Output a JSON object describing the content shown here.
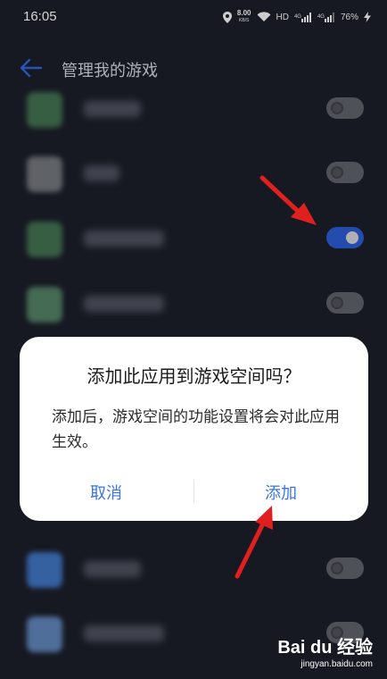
{
  "status_bar": {
    "time": "16:05",
    "net_speed_value": "8.00",
    "net_speed_unit": "KB/S",
    "hd_label": "HD",
    "sig1_label": "4G",
    "sig2_label": "4G",
    "battery": "76%",
    "icons": [
      "location-icon",
      "wifi-icon",
      "signal-icon",
      "signal-icon",
      "charging-icon"
    ]
  },
  "header": {
    "title": "管理我的游戏",
    "back_icon": "arrow-left-icon"
  },
  "game_list": {
    "items": [
      {
        "name_label": "",
        "toggle_on": false,
        "icon_color": "#3f6b4c"
      },
      {
        "name_label": "",
        "toggle_on": false,
        "icon_color": "#6d7076"
      },
      {
        "name_label": "",
        "toggle_on": true,
        "icon_color": "#3f6b4c"
      },
      {
        "name_label": "",
        "toggle_on": false,
        "icon_color": "#4f7a60"
      },
      {
        "name_label": "",
        "toggle_on": false,
        "icon_color": "#3d6fb8"
      },
      {
        "name_label": "",
        "toggle_on": false,
        "icon_color": "#5a7fb0"
      }
    ]
  },
  "dialog": {
    "title": "添加此应用到游戏空间吗？",
    "message": "添加后，游戏空间的功能设置将会对此应用生效。",
    "cancel_label": "取消",
    "add_label": "添加"
  },
  "watermark": {
    "logo_text": "Bai du 经验",
    "url": "jingyan.baidu.com"
  },
  "colors": {
    "background": "#1a1d27",
    "accent": "#3a74e6",
    "toggle_on": "#2a57c7",
    "annotation_arrow": "#e0201e"
  }
}
